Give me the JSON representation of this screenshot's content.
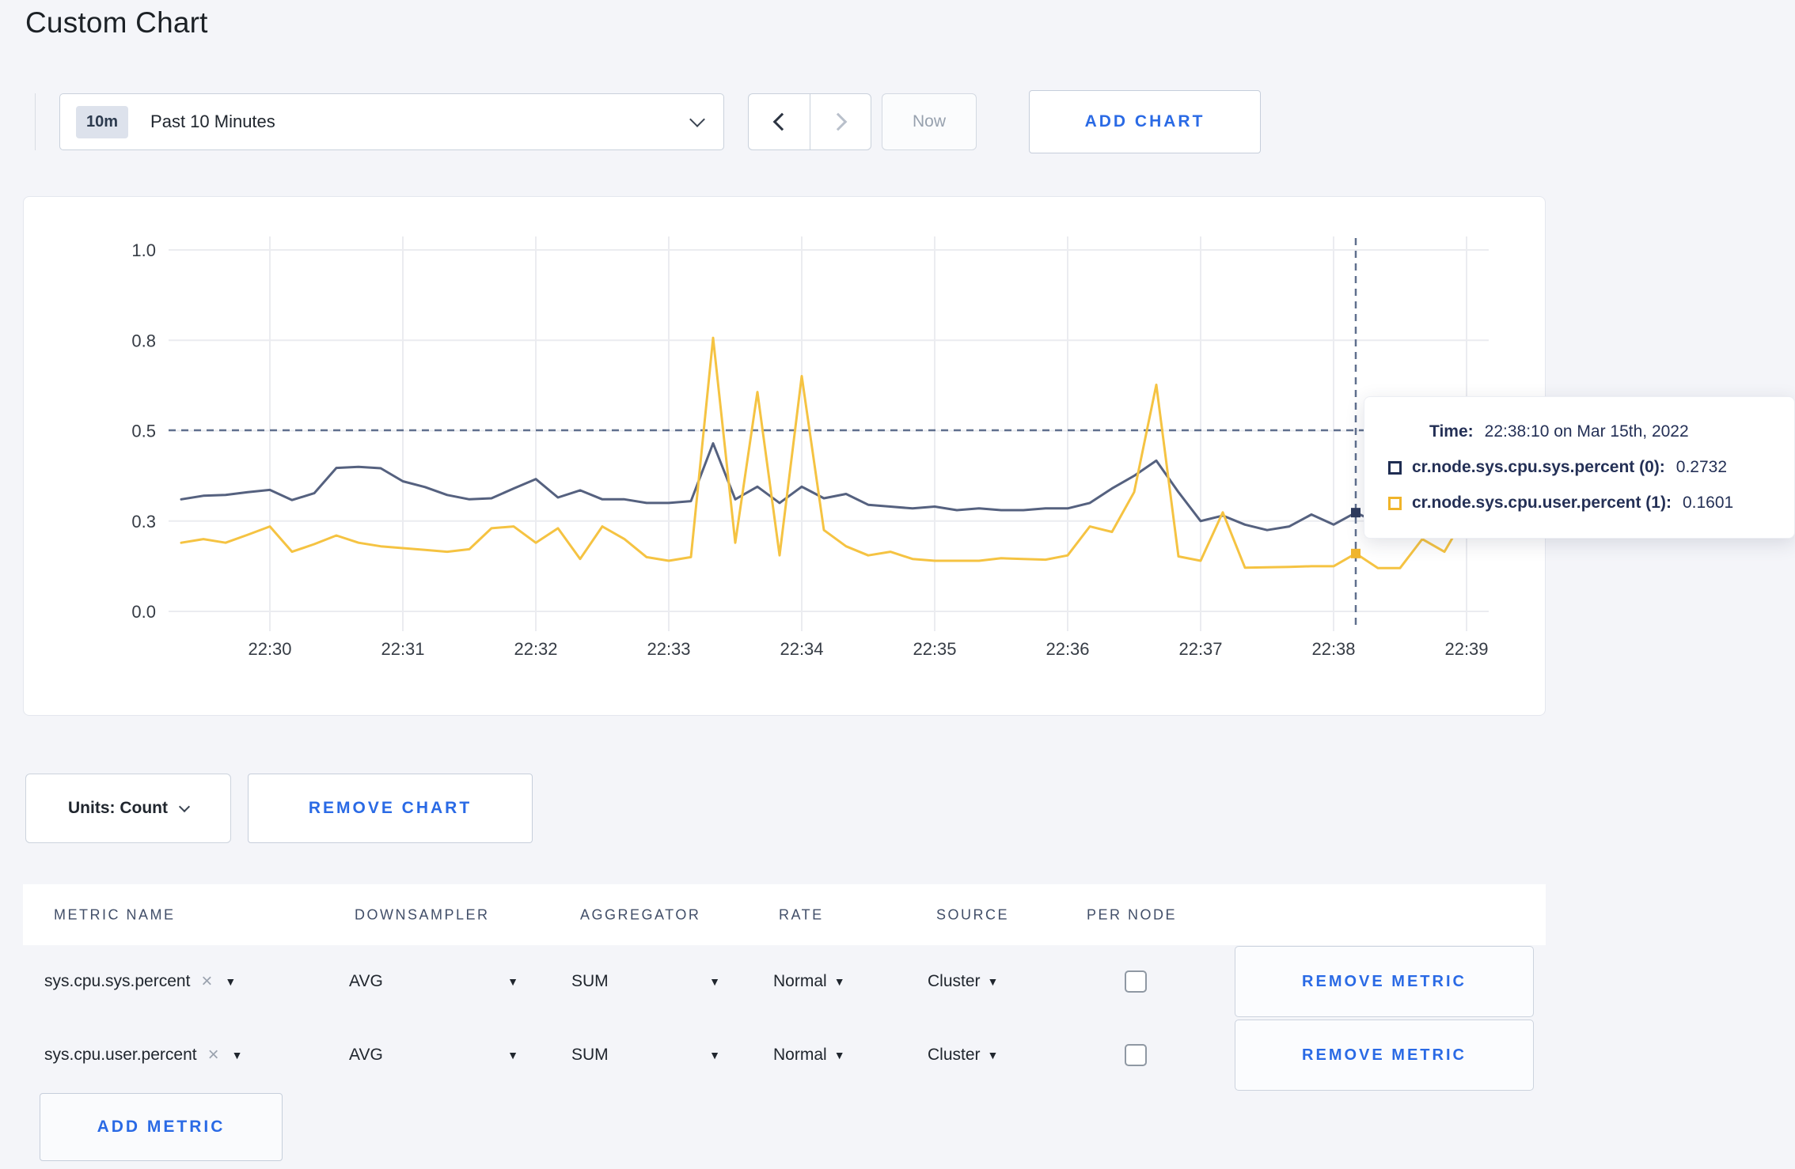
{
  "page": {
    "title": "Custom Chart"
  },
  "toolbar": {
    "time_badge": "10m",
    "time_label": "Past 10 Minutes",
    "now_label": "Now",
    "add_chart_label": "ADD CHART"
  },
  "chart_section": {
    "units_label": "Units: Count",
    "remove_chart_label": "REMOVE CHART"
  },
  "tooltip": {
    "time_key": "Time:",
    "time_value": "22:38:10 on Mar 15th, 2022",
    "series": [
      {
        "name": "cr.node.sys.cpu.sys.percent (0):",
        "value": "0.2732",
        "color": "#1f2d52"
      },
      {
        "name": "cr.node.sys.cpu.user.percent (1):",
        "value": "0.1601",
        "color": "#f0b429"
      }
    ]
  },
  "metrics_table": {
    "headers": [
      "METRIC NAME",
      "DOWNSAMPLER",
      "AGGREGATOR",
      "RATE",
      "SOURCE",
      "PER NODE"
    ],
    "rows": [
      {
        "metric": "sys.cpu.sys.percent",
        "downsampler": "AVG",
        "aggregator": "SUM",
        "rate": "Normal",
        "source": "Cluster",
        "per_node_checked": false,
        "remove_label": "REMOVE METRIC"
      },
      {
        "metric": "sys.cpu.user.percent",
        "downsampler": "AVG",
        "aggregator": "SUM",
        "rate": "Normal",
        "source": "Cluster",
        "per_node_checked": false,
        "remove_label": "REMOVE METRIC"
      }
    ],
    "add_metric_label": "ADD METRIC"
  },
  "chart_data": {
    "type": "line",
    "title": "",
    "xlabel": "",
    "ylabel": "",
    "ylim": [
      0,
      1
    ],
    "grid": true,
    "y_ticks": [
      {
        "value": 0.0,
        "label": "0.0"
      },
      {
        "value": 0.25,
        "label": "0.3"
      },
      {
        "value": 0.5,
        "label": "0.5"
      },
      {
        "value": 0.75,
        "label": "0.8"
      },
      {
        "value": 1.0,
        "label": "1.0"
      }
    ],
    "x_tick_labels": [
      "22:30",
      "22:31",
      "22:32",
      "22:33",
      "22:34",
      "22:35",
      "22:36",
      "22:37",
      "22:38",
      "22:39"
    ],
    "sample_step_seconds": 10,
    "t_start_seconds": -40,
    "series": [
      {
        "name": "cr.node.sys.cpu.sys.percent",
        "color": "#55617f",
        "values": [
          0.31,
          0.32,
          0.322,
          0.33,
          0.336,
          0.308,
          0.327,
          0.397,
          0.4,
          0.396,
          0.36,
          0.344,
          0.322,
          0.31,
          0.313,
          0.34,
          0.366,
          0.315,
          0.335,
          0.31,
          0.31,
          0.3,
          0.3,
          0.305,
          0.465,
          0.31,
          0.345,
          0.3,
          0.345,
          0.313,
          0.325,
          0.295,
          0.29,
          0.285,
          0.29,
          0.28,
          0.285,
          0.28,
          0.28,
          0.285,
          0.285,
          0.3,
          0.34,
          0.375,
          0.417,
          0.33,
          0.25,
          0.265,
          0.24,
          0.225,
          0.235,
          0.268,
          0.24,
          0.2732,
          0.245,
          0.27,
          0.29,
          0.3,
          0.3,
          0.31
        ]
      },
      {
        "name": "cr.node.sys.cpu.user.percent",
        "color": "#f5c342",
        "values": [
          0.19,
          0.2,
          0.19,
          0.212,
          0.235,
          0.165,
          0.186,
          0.21,
          0.19,
          0.18,
          0.175,
          0.17,
          0.165,
          0.172,
          0.23,
          0.235,
          0.19,
          0.23,
          0.145,
          0.235,
          0.2,
          0.15,
          0.14,
          0.15,
          0.757,
          0.19,
          0.607,
          0.155,
          0.651,
          0.225,
          0.18,
          0.155,
          0.165,
          0.145,
          0.14,
          0.14,
          0.14,
          0.147,
          0.145,
          0.143,
          0.155,
          0.235,
          0.22,
          0.33,
          0.627,
          0.152,
          0.14,
          0.274,
          0.121,
          0.122,
          0.123,
          0.125,
          0.125,
          0.1601,
          0.12,
          0.12,
          0.2,
          0.165,
          0.27,
          0.24
        ]
      }
    ],
    "crosshair": {
      "time_label": "22:38:10",
      "t_seconds": 490,
      "horizontal_value": 0.501,
      "point_values": [
        0.2732,
        0.1601
      ],
      "point_colors": [
        "#2e3c5e",
        "#f0b52e"
      ]
    }
  }
}
